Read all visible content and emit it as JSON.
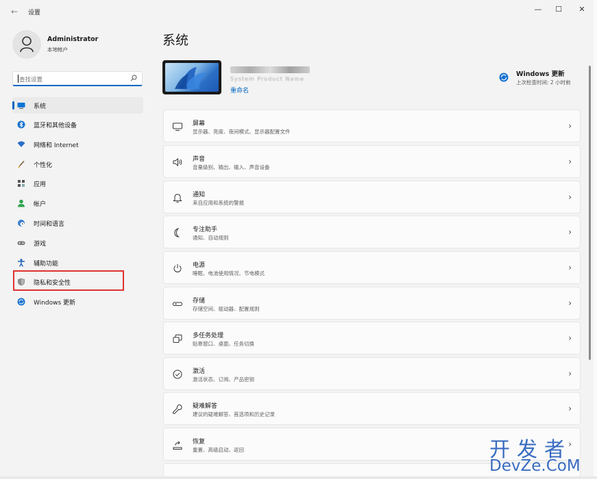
{
  "window": {
    "title": "设置",
    "controls": [
      "—",
      "☐",
      "✕"
    ]
  },
  "user": {
    "name": "Administrator",
    "account_type": "本地帐户"
  },
  "search": {
    "placeholder": "查找设置"
  },
  "sidebar": {
    "items": [
      {
        "label": "系统",
        "icon": "system-icon",
        "active": true
      },
      {
        "label": "蓝牙和其他设备",
        "icon": "bluetooth-icon"
      },
      {
        "label": "网络和 Internet",
        "icon": "wifi-icon"
      },
      {
        "label": "个性化",
        "icon": "brush-icon"
      },
      {
        "label": "应用",
        "icon": "apps-icon"
      },
      {
        "label": "帐户",
        "icon": "account-icon"
      },
      {
        "label": "时间和语言",
        "icon": "globe-clock-icon"
      },
      {
        "label": "游戏",
        "icon": "gamepad-icon"
      },
      {
        "label": "辅助功能",
        "icon": "accessibility-icon"
      },
      {
        "label": "隐私和安全性",
        "icon": "shield-icon",
        "highlighted": true
      },
      {
        "label": "Windows 更新",
        "icon": "update-icon"
      }
    ]
  },
  "main": {
    "title": "系统",
    "device": {
      "model": "System Product Name",
      "rename": "重命名"
    },
    "windows_update": {
      "title": "Windows 更新",
      "subtitle": "上次检查时间: 2 小时前"
    },
    "cards": [
      {
        "title": "屏幕",
        "desc": "显示器、亮度、夜间模式、显示器配置文件",
        "icon": "monitor-icon"
      },
      {
        "title": "声音",
        "desc": "音量级别、输出、输入、声音设备",
        "icon": "speaker-icon"
      },
      {
        "title": "通知",
        "desc": "来自应用和系统的警报",
        "icon": "bell-icon"
      },
      {
        "title": "专注助手",
        "desc": "通知、自动规则",
        "icon": "moon-icon"
      },
      {
        "title": "电源",
        "desc": "睡眠、电池使用情况、节电模式",
        "icon": "power-icon"
      },
      {
        "title": "存储",
        "desc": "存储空间、驱动器、配置规则",
        "icon": "storage-icon"
      },
      {
        "title": "多任务处理",
        "desc": "贴靠窗口、桌面、任务切换",
        "icon": "multitask-icon"
      },
      {
        "title": "激活",
        "desc": "激活状态、订阅、产品密钥",
        "icon": "check-circle-icon"
      },
      {
        "title": "疑难解答",
        "desc": "建议的疑难解答、首选项和历史记录",
        "icon": "wrench-icon"
      },
      {
        "title": "恢复",
        "desc": "重置、高级启动、返回",
        "icon": "recovery-icon"
      }
    ]
  },
  "watermark": {
    "cn": "开发者",
    "en": "DevZe.CoM"
  },
  "colors": {
    "accent": "#0067c0",
    "highlight": "#e0312f",
    "watermark": "#3a6cc0"
  }
}
